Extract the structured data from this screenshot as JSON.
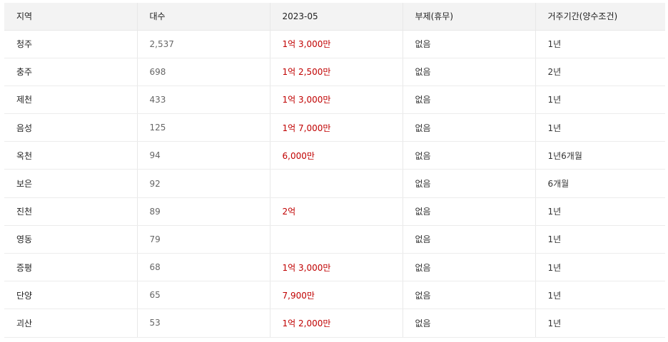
{
  "table": {
    "headers": [
      "지역",
      "대수",
      "2023-05",
      "부제(휴무)",
      "거주기간(양수조건)"
    ],
    "rows": [
      {
        "region": "청주",
        "count": "2,537",
        "price": "1억 3,000만",
        "vacation": "없음",
        "residence": "1년"
      },
      {
        "region": "충주",
        "count": "698",
        "price": "1억 2,500만",
        "vacation": "없음",
        "residence": "2년"
      },
      {
        "region": "제천",
        "count": "433",
        "price": "1억 3,000만",
        "vacation": "없음",
        "residence": "1년"
      },
      {
        "region": "음성",
        "count": "125",
        "price": "1억 7,000만",
        "vacation": "없음",
        "residence": "1년"
      },
      {
        "region": "옥천",
        "count": "94",
        "price": "6,000만",
        "vacation": "없음",
        "residence": "1년6개월"
      },
      {
        "region": "보은",
        "count": "92",
        "price": "",
        "vacation": "없음",
        "residence": "6개월"
      },
      {
        "region": "진천",
        "count": "89",
        "price": "2억",
        "vacation": "없음",
        "residence": "1년"
      },
      {
        "region": "영동",
        "count": "79",
        "price": "",
        "vacation": "없음",
        "residence": "1년"
      },
      {
        "region": "증평",
        "count": "68",
        "price": "1억 3,000만",
        "vacation": "없음",
        "residence": "1년"
      },
      {
        "region": "단양",
        "count": "65",
        "price": "7,900만",
        "vacation": "없음",
        "residence": "1년"
      },
      {
        "region": "괴산",
        "count": "53",
        "price": "1억 2,000만",
        "vacation": "없음",
        "residence": "1년"
      }
    ]
  },
  "colors": {
    "header_bg": "#f3f3f3",
    "price_text": "#c00000",
    "border": "#e8e8e8"
  }
}
